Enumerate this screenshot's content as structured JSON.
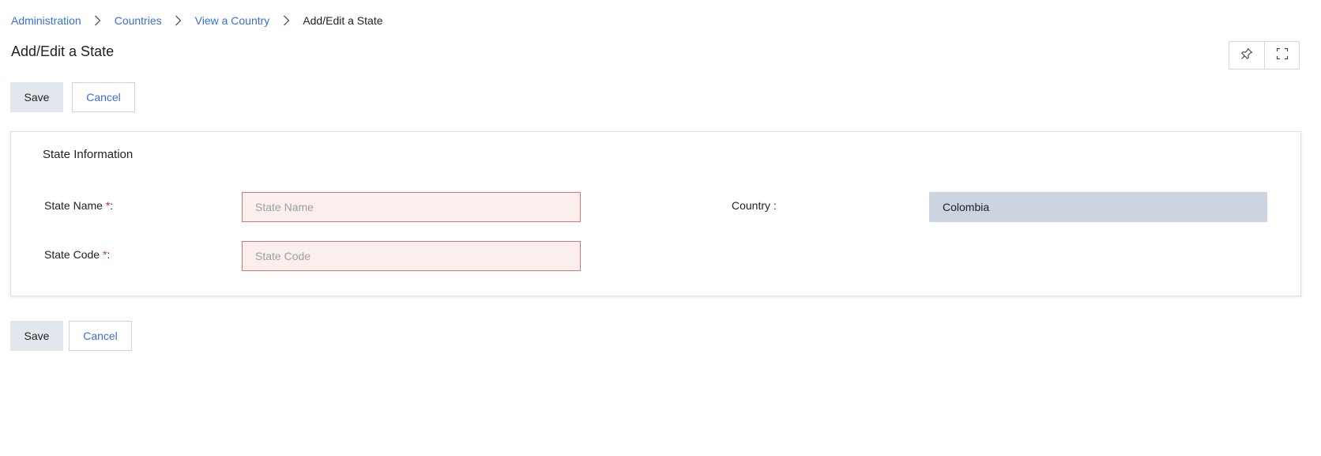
{
  "breadcrumb": {
    "items": [
      {
        "label": "Administration"
      },
      {
        "label": "Countries"
      },
      {
        "label": "View a Country"
      },
      {
        "label": "Add/Edit a State"
      }
    ]
  },
  "page": {
    "title": "Add/Edit a State"
  },
  "toolbar": {
    "icons": [
      "pin-icon",
      "fullscreen-icon"
    ]
  },
  "actions": {
    "save_label": "Save",
    "cancel_label": "Cancel"
  },
  "panel": {
    "title": "State Information",
    "fields": {
      "state_name": {
        "label": "State Name",
        "required_mark": "*",
        "suffix": ":",
        "value": "",
        "placeholder": "State Name"
      },
      "state_code": {
        "label": "State Code",
        "required_mark": "*",
        "suffix": ":",
        "value": "",
        "placeholder": "State Code"
      },
      "country": {
        "label": "Country :",
        "value": "Colombia"
      }
    }
  },
  "colors": {
    "link": "#3b6fd4",
    "save_bg": "#e2e7ee",
    "error_bg": "#fdeeee",
    "error_border": "#d9777a",
    "readonly_bg": "#cbd4df",
    "required": "#d0312d"
  }
}
